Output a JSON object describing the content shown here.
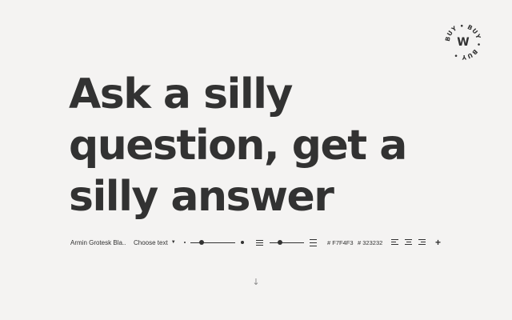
{
  "badge": {
    "ring_text": "BUY • BUY • BUY • ",
    "letter": "W"
  },
  "headline": "Ask a silly question, get a silly answer",
  "toolbar": {
    "font_name": "Armin Grotesk Bla...",
    "choose_text": "Choose text",
    "size_slider": {
      "value_fraction": 0.25
    },
    "leading_slider": {
      "value_fraction": 0.3
    },
    "background_color": "# F7F4F3",
    "text_color": "# 323232",
    "add_label": "+"
  },
  "icons": {
    "caret": "caret-down-icon",
    "scroll": "arrow-down-icon"
  },
  "colors": {
    "background": "#F4F3F2",
    "text": "#323232"
  }
}
